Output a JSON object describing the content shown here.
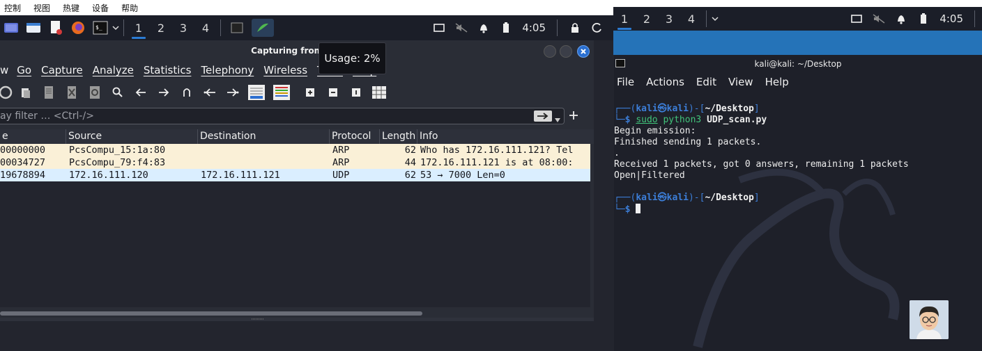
{
  "host_menu": [
    "控制",
    "视图",
    "热键",
    "设备",
    "帮助"
  ],
  "panel_left": {
    "workspaces": [
      "1",
      "2",
      "3",
      "4"
    ],
    "active_workspace": "1",
    "clock": "4:05"
  },
  "panel_right": {
    "workspaces": [
      "1",
      "2",
      "3",
      "4"
    ],
    "active_workspace": "1",
    "clock": "4:05"
  },
  "wireshark": {
    "title": "Capturing from any",
    "menu": [
      "w",
      "Go",
      "Capture",
      "Analyze",
      "Statistics",
      "Telephony",
      "Wireless",
      "Tools",
      "Help"
    ],
    "filter_placeholder": "ay filter … <Ctrl-/>",
    "columns": [
      "e",
      "Source",
      "Destination",
      "Protocol",
      "Length",
      "Info"
    ],
    "packets": [
      {
        "time": "00000000",
        "source": "PcsCompu_15:1a:80",
        "destination": "",
        "protocol": "ARP",
        "length": "62",
        "info": "Who has 172.16.111.121? Tel",
        "color": "#faf0d7"
      },
      {
        "time": "00034727",
        "source": "PcsCompu_79:f4:83",
        "destination": "",
        "protocol": "ARP",
        "length": "44",
        "info": "172.16.111.121 is at 08:00:",
        "color": "#faf0d7"
      },
      {
        "time": "19678894",
        "source": "172.16.111.120",
        "destination": "172.16.111.121",
        "protocol": "UDP",
        "length": "62",
        "info": "53 → 7000 Len=0",
        "color": "#daeeff"
      }
    ]
  },
  "tooltip": "Usage: 2%",
  "terminal": {
    "title": "kali@kali: ~/Desktop",
    "menu": [
      "File",
      "Actions",
      "Edit",
      "View",
      "Help"
    ],
    "prompt_user": "kali",
    "prompt_at": "㉿",
    "prompt_host": "kali",
    "prompt_dir": "~/Desktop",
    "command_sudo": "sudo",
    "command_python": "python3",
    "command_script": "UDP_scan.py",
    "output": [
      "Begin emission:",
      "Finished sending 1 packets.",
      ".",
      "Received 1 packets, got 0 answers, remaining 1 packets",
      "Open|Filtered"
    ]
  }
}
